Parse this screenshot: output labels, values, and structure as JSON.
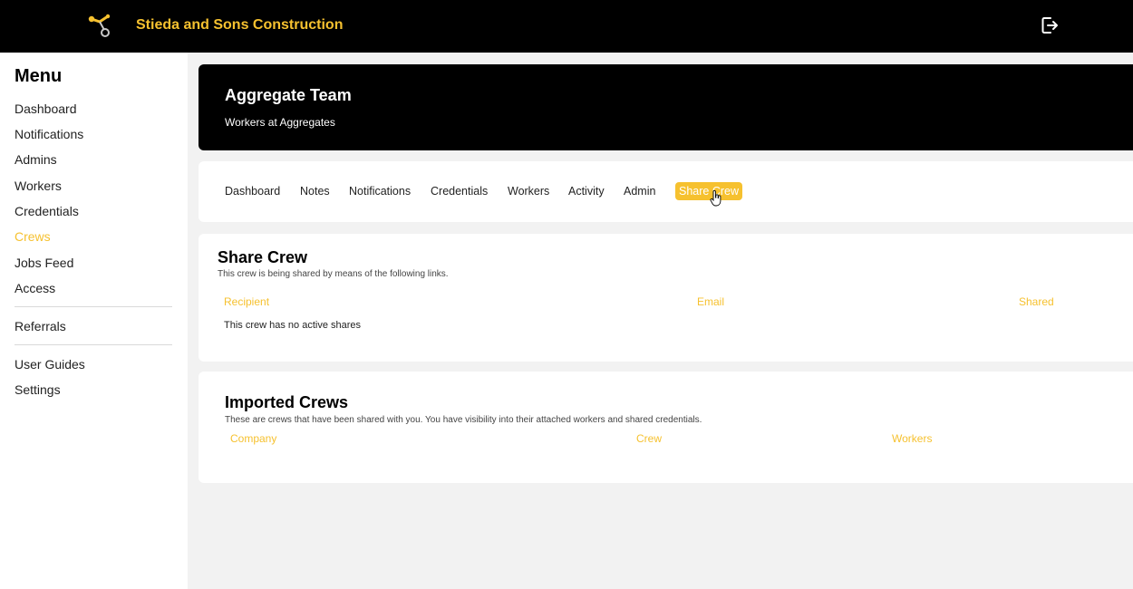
{
  "header": {
    "brand": "Stieda and Sons Construction",
    "logo_icon": "crane-hook-icon",
    "logout_icon": "logout-icon"
  },
  "sidebar": {
    "title": "Menu",
    "items": [
      {
        "label": "Dashboard"
      },
      {
        "label": "Notifications"
      },
      {
        "label": "Admins"
      },
      {
        "label": "Workers"
      },
      {
        "label": "Credentials"
      },
      {
        "label": "Crews",
        "active": true
      },
      {
        "label": "Jobs Feed"
      },
      {
        "label": "Access"
      },
      {
        "label": "Referrals"
      },
      {
        "label": "User Guides"
      },
      {
        "label": "Settings"
      }
    ]
  },
  "team": {
    "title": "Aggregate Team",
    "subtitle": "Workers at Aggregates"
  },
  "tabs": [
    {
      "label": "Dashboard"
    },
    {
      "label": "Notes"
    },
    {
      "label": "Notifications"
    },
    {
      "label": "Credentials"
    },
    {
      "label": "Workers"
    },
    {
      "label": "Activity"
    },
    {
      "label": "Admin"
    },
    {
      "label": "Share Crew",
      "active": true
    }
  ],
  "share_crew": {
    "title": "Share Crew",
    "subtitle": "This crew is being shared by means of the following links.",
    "columns": [
      "Recipient",
      "Email",
      "Shared"
    ],
    "empty_message": "This crew has no active shares"
  },
  "imported_crews": {
    "title": "Imported Crews",
    "subtitle": "These are crews that have been shared with you. You have visibility into their attached workers and shared credentials.",
    "columns": [
      "Company",
      "Crew",
      "Workers"
    ]
  },
  "colors": {
    "accent": "#f6c12f",
    "topbar": "#000000",
    "background": "#f2f2f2"
  }
}
